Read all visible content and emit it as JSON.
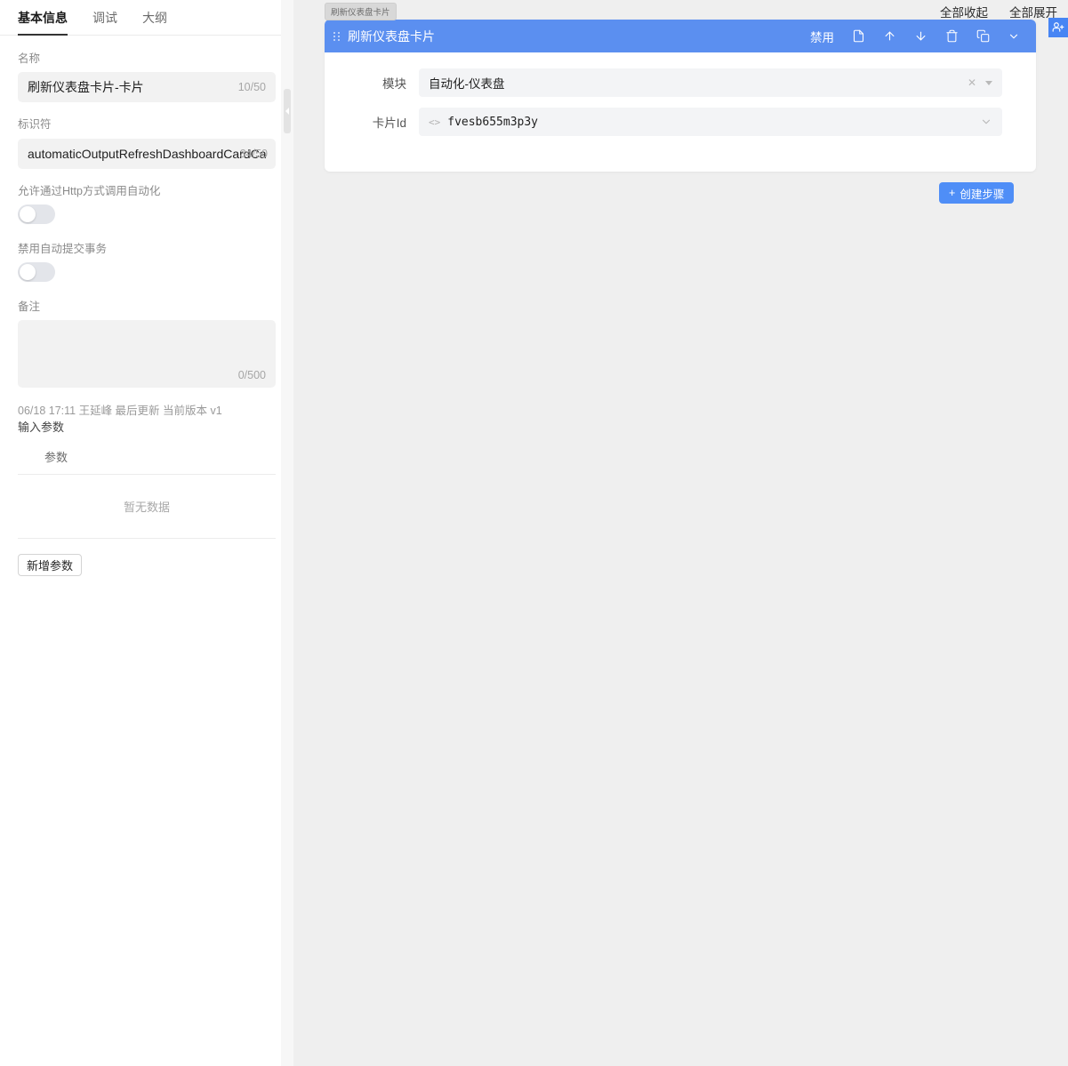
{
  "left_panel": {
    "tabs": [
      {
        "label": "基本信息",
        "active": true
      },
      {
        "label": "调试",
        "active": false
      },
      {
        "label": "大纲",
        "active": false
      }
    ],
    "name_field": {
      "label": "名称",
      "value": "刷新仪表盘卡片-卡片",
      "counter": "10/50"
    },
    "identifier_field": {
      "label": "标识符",
      "value": "automaticOutputRefreshDashboardCardCard",
      "counter": "34/50"
    },
    "http_switch": {
      "label": "允许通过Http方式调用自动化",
      "state": "off"
    },
    "transaction_switch": {
      "label": "禁用自动提交事务",
      "state": "off"
    },
    "remark_field": {
      "label": "备注",
      "value": "",
      "counter": "0/500"
    },
    "meta": {
      "update_line": "06/18 17:11 王延峰 最后更新 当前版本 v1",
      "params_title": "输入参数"
    },
    "param_table": {
      "column_header": "参数",
      "empty_text": "暂无数据",
      "add_button": "新增参数"
    },
    "resize_handle": {
      "icon": "chevron-left-icon"
    }
  },
  "right_panel": {
    "top_actions": [
      {
        "label": "全部收起",
        "name": "collapse-all"
      },
      {
        "label": "全部展开",
        "name": "expand-all"
      }
    ],
    "user_badge_icon": "user-add-icon",
    "drag_tag": "刷新仪表盘卡片",
    "step_card": {
      "title": "刷新仪表盘卡片",
      "drag_handle_icon": "drag-dots-icon",
      "tools": [
        {
          "label": "禁用",
          "type": "text",
          "name": "disable-action"
        },
        {
          "label": "",
          "type": "icon",
          "icon": "document-icon",
          "name": "note-action"
        },
        {
          "label": "",
          "type": "icon",
          "icon": "arrow-up-icon",
          "name": "move-up-action"
        },
        {
          "label": "",
          "type": "icon",
          "icon": "arrow-down-icon",
          "name": "move-down-action"
        },
        {
          "label": "",
          "type": "icon",
          "icon": "trash-icon",
          "name": "delete-action"
        },
        {
          "label": "",
          "type": "icon",
          "icon": "copy-icon",
          "name": "duplicate-action"
        },
        {
          "label": "",
          "type": "icon",
          "icon": "chevron-down-icon",
          "name": "collapse-action"
        }
      ],
      "rows": [
        {
          "label": "模块",
          "value": "自动化-仪表盘",
          "has_code_icon": false,
          "has_clear": true,
          "has_caret": true,
          "name": "module-select"
        },
        {
          "label": "卡片Id",
          "value": "fvesb655m3p3y",
          "has_code_icon": true,
          "has_clear": false,
          "has_caret": false,
          "has_chevron": true,
          "name": "card-id-input"
        }
      ]
    },
    "create_step_button": {
      "plus": "+",
      "label": "创建步骤"
    }
  },
  "colors": {
    "accent_blue": "#4f8ef7",
    "card_header_blue": "#5b8ff0",
    "page_bg": "#efefef",
    "field_bg": "#f2f2f2"
  }
}
